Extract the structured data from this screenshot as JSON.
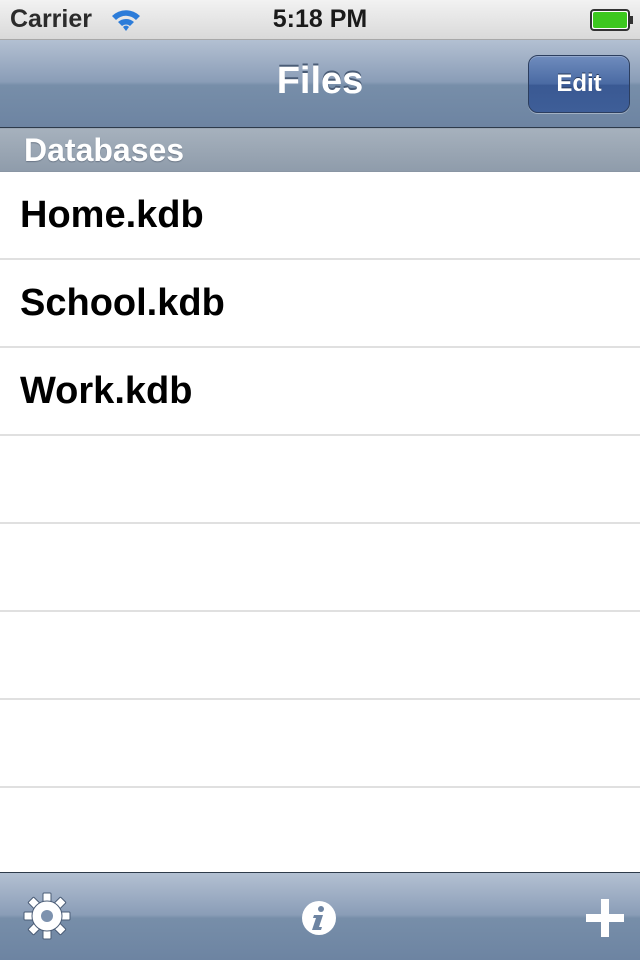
{
  "status_bar": {
    "carrier": "Carrier",
    "time": "5:18 PM",
    "icons": [
      "wifi-icon",
      "battery-icon"
    ]
  },
  "nav_bar": {
    "title": "Files",
    "edit_label": "Edit"
  },
  "section": {
    "title": "Databases"
  },
  "files": [
    {
      "name": "Home.kdb"
    },
    {
      "name": "School.kdb"
    },
    {
      "name": "Work.kdb"
    }
  ],
  "toolbar": {
    "icons": [
      "gear-icon",
      "info-icon",
      "plus-icon"
    ]
  },
  "colors": {
    "nav_bar": "#8a9db7",
    "edit_button": "#4a6aa3",
    "section_header": "#98a4b2",
    "battery": "#3cc81e"
  }
}
